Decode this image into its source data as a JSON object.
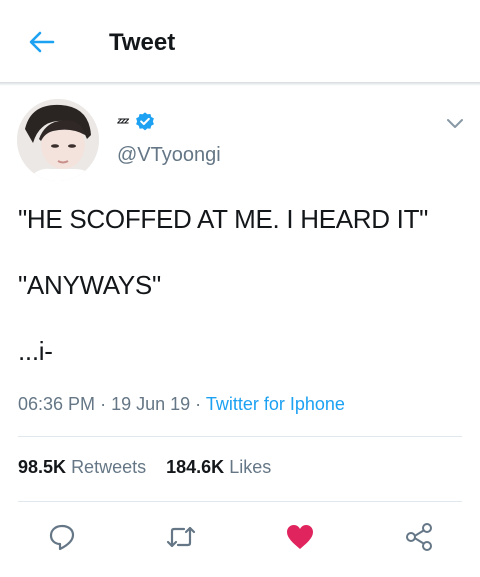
{
  "header": {
    "title": "Tweet",
    "back_icon": "arrow-left-icon",
    "accent": "#1da1f2"
  },
  "tweet": {
    "display_name": "ᶻᶻᶻ",
    "verified_icon": "verified-badge-icon",
    "handle": "@VTyoongi",
    "text": "\"HE SCOFFED AT ME. I HEARD IT\"\n\n\"ANYWAYS\"\n\n...i-",
    "time": "06:36 PM",
    "date": "19 Jun 19",
    "separator": "·",
    "source": "Twitter for Iphone",
    "retweets_count": "98.5K",
    "retweets_label": "Retweets",
    "likes_count": "184.6K",
    "likes_label": "Likes"
  },
  "actions": {
    "reply_icon": "reply-icon",
    "retweet_icon": "retweet-icon",
    "like_icon": "heart-icon",
    "like_color": "#e0245e",
    "share_icon": "share-icon"
  }
}
